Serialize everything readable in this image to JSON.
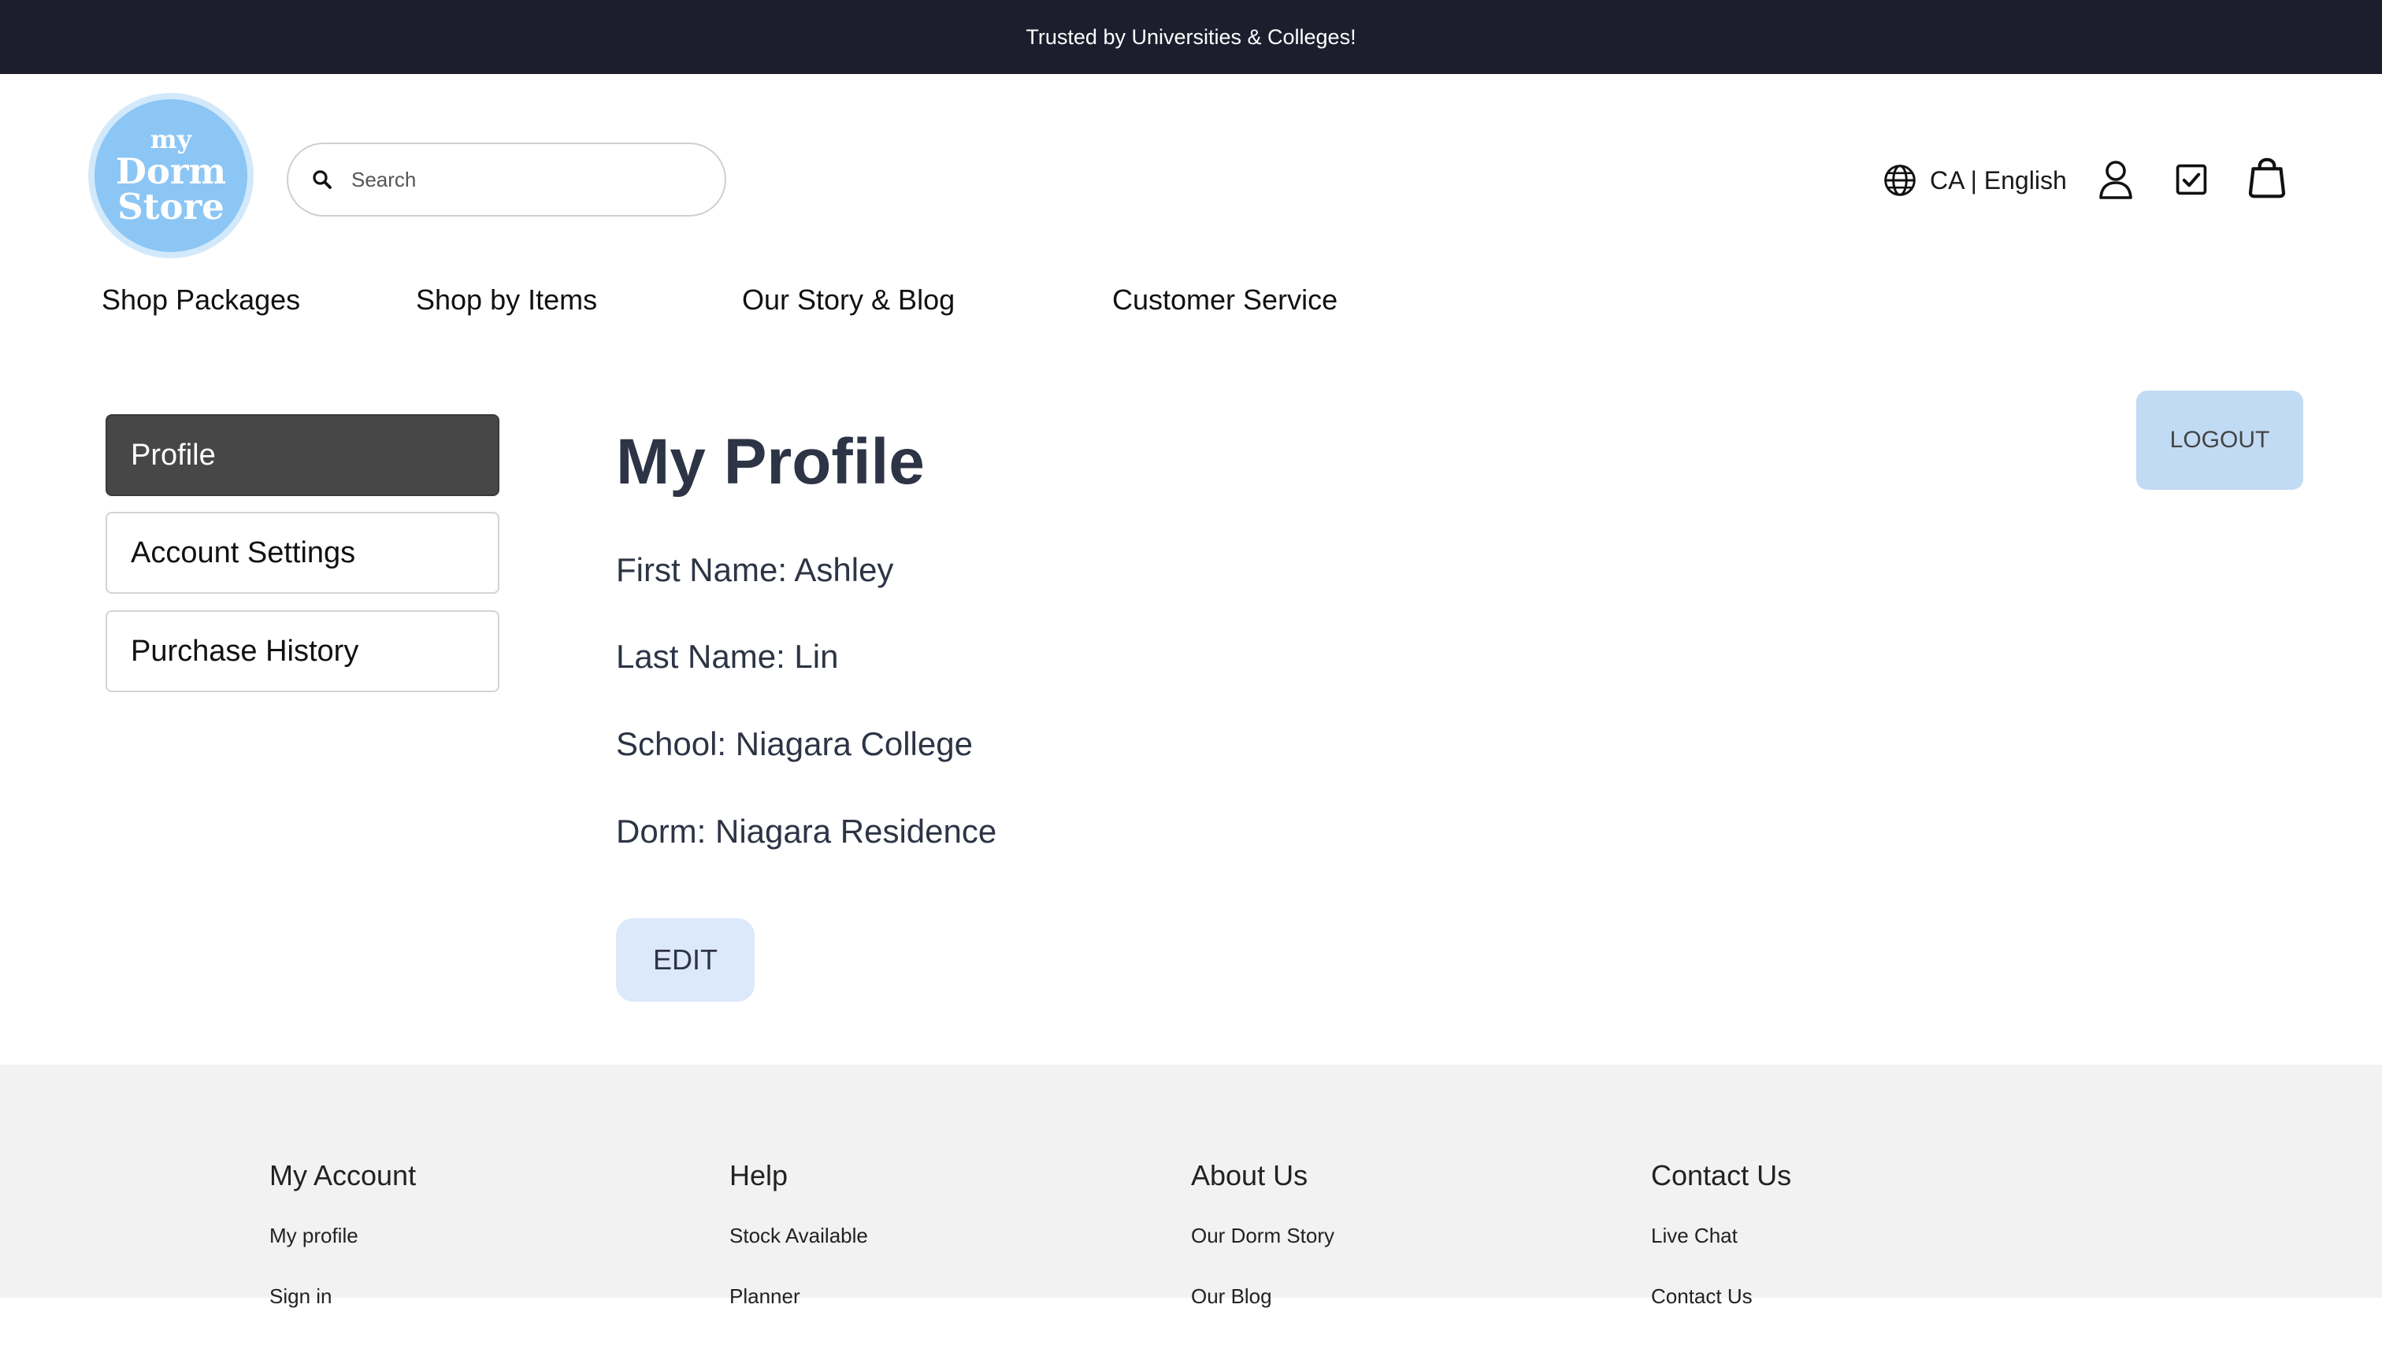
{
  "announcement": "Trusted by Universities & Colleges!",
  "logo": {
    "line1": "my",
    "line2": "Dorm",
    "line3": "Store"
  },
  "search": {
    "placeholder": "Search",
    "value": ""
  },
  "header": {
    "locale": "CA | English"
  },
  "icons": [
    "globe-icon",
    "user-icon",
    "checklist-icon",
    "shopping-bag-icon",
    "search-icon"
  ],
  "nav": [
    "Shop Packages",
    "Shop by Items",
    "Our Story & Blog",
    "Customer Service"
  ],
  "sidebar": {
    "items": [
      {
        "label": "Profile",
        "active": true
      },
      {
        "label": "Account Settings",
        "active": false
      },
      {
        "label": "Purchase History",
        "active": false
      }
    ]
  },
  "profile": {
    "title": "My Profile",
    "fields": [
      "First Name: Ashley",
      "Last Name: Lin",
      "School: Niagara College",
      "Dorm: Niagara Residence"
    ],
    "edit_label": "EDIT",
    "logout_label": "LOGOUT"
  },
  "footer": {
    "columns": [
      {
        "heading": "My Account",
        "links": [
          "My profile",
          "Sign in"
        ]
      },
      {
        "heading": "Help",
        "links": [
          "Stock Available",
          "Planner"
        ]
      },
      {
        "heading": "About Us",
        "links": [
          "Our Dorm Story",
          "Our Blog"
        ]
      },
      {
        "heading": "Contact Us",
        "links": [
          "Live Chat",
          "Contact Us"
        ]
      }
    ]
  },
  "colors": {
    "topbar": "#1c1e2e",
    "logo": "#8cc6f5",
    "sidebar_active": "#474747",
    "edit_button": "#dbe9fb",
    "logout_button": "#c2dbf4",
    "footer": "#f2f2f2",
    "heading_text": "#2d3445"
  }
}
